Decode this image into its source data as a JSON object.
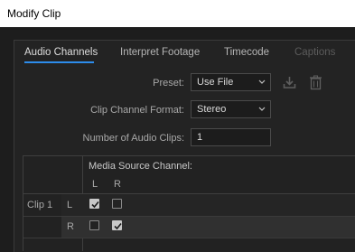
{
  "window": {
    "title": "Modify Clip"
  },
  "tabs": [
    {
      "label": "Audio Channels"
    },
    {
      "label": "Interpret Footage"
    },
    {
      "label": "Timecode"
    },
    {
      "label": "Captions"
    }
  ],
  "form": {
    "preset_label": "Preset:",
    "preset_value": "Use File",
    "format_label": "Clip Channel Format:",
    "format_value": "Stereo",
    "clips_label": "Number of Audio Clips:",
    "clips_value": "1"
  },
  "grid": {
    "header": "Media Source Channel:",
    "columns": [
      "L",
      "R"
    ],
    "clip_label": "Clip 1",
    "rows": [
      {
        "channel": "L",
        "checks": [
          true,
          false
        ]
      },
      {
        "channel": "R",
        "checks": [
          false,
          true
        ]
      }
    ]
  },
  "colors": {
    "accent": "#2d8ceb",
    "background": "#1d1d1d",
    "row_highlight": "#303030"
  }
}
